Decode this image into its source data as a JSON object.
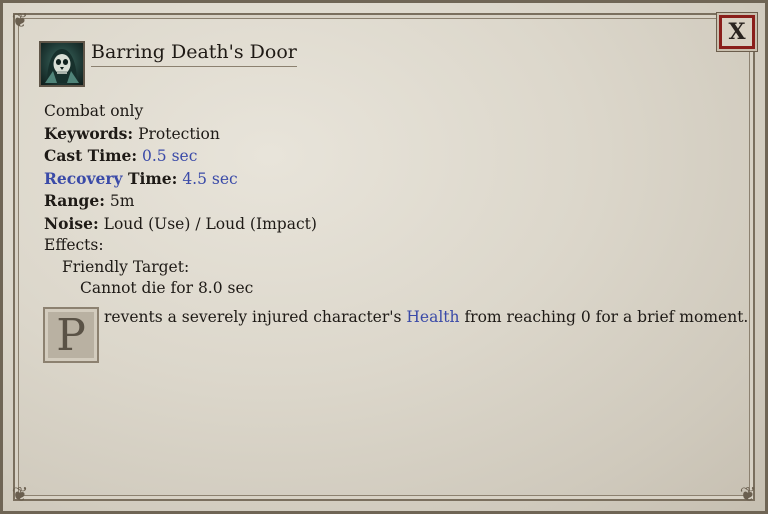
{
  "window": {
    "title": "Barring Death's Door",
    "close_label": "X"
  },
  "details": {
    "usage": "Combat only",
    "keywords_label": "Keywords:",
    "keywords_value": "Protection",
    "cast_label": "Cast Time:",
    "cast_value": "0.5 sec",
    "recovery_word": "Recovery",
    "recovery_label_rest": " Time:",
    "recovery_value": "4.5 sec",
    "range_label": "Range:",
    "range_value": "5m",
    "noise_label": "Noise:",
    "noise_value": "Loud (Use) / Loud (Impact)",
    "effects_label": "Effects:",
    "target_label": "Friendly Target:",
    "effect_text": "Cannot die for 8.0 sec"
  },
  "description": {
    "drop_cap": "P",
    "text_before": "revents a severely injured character's ",
    "link": "Health",
    "text_after": " from reaching 0 for a brief moment."
  },
  "colors": {
    "highlight": "#3a4aa8",
    "close_border": "#8a1e1a"
  },
  "icons": {
    "ability": "skull-hooded-icon",
    "corner": "ornament-icon"
  }
}
